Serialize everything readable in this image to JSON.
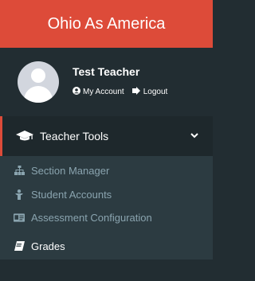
{
  "header": {
    "title": "Ohio As America"
  },
  "user": {
    "name": "Test Teacher",
    "my_account": "My Account",
    "logout": "Logout"
  },
  "menu": {
    "section_label": "Teacher Tools",
    "items": [
      {
        "label": "Section Manager",
        "icon": "sitemap-icon"
      },
      {
        "label": "Student Accounts",
        "icon": "user-icon"
      },
      {
        "label": "Assessment Configuration",
        "icon": "id-card-icon"
      },
      {
        "label": "Grades",
        "icon": "book-icon"
      }
    ]
  },
  "colors": {
    "brand": "#dd4b39",
    "sidebar": "#222d32",
    "submenu": "#2c3b41",
    "active_text": "#ffffff",
    "muted_text": "#8aa4af"
  }
}
